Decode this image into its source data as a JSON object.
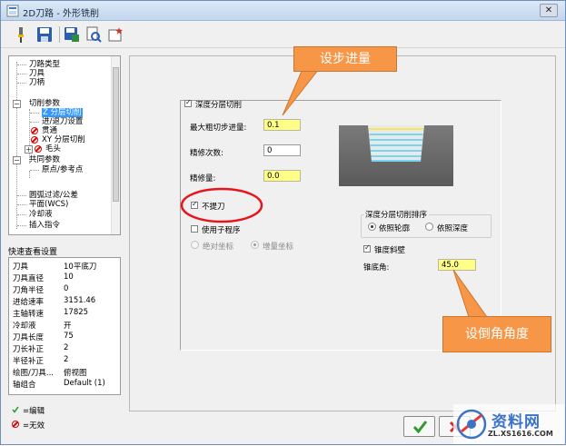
{
  "window": {
    "title": "2D刀路 - 外形铣削"
  },
  "toolbar": {
    "icons": [
      "tool-icon",
      "save-icon",
      "save-as-icon",
      "view-icon",
      "new-icon"
    ]
  },
  "tree": {
    "items": [
      {
        "label": "刀路类型"
      },
      {
        "label": "刀具"
      },
      {
        "label": "刀柄"
      },
      {
        "label": "切削参数"
      },
      {
        "label": "Z 分层切削"
      },
      {
        "label": "进/退刀设置"
      },
      {
        "label": "贯通"
      },
      {
        "label": "XY 分层切削"
      },
      {
        "label": "毛头"
      },
      {
        "label": "共同参数"
      },
      {
        "label": "原点/参考点"
      },
      {
        "label": "圆弧过滤/公差"
      },
      {
        "label": "平面(WCS)"
      },
      {
        "label": "冷却液"
      },
      {
        "label": "插入指令"
      }
    ]
  },
  "quick_view": {
    "label": "快速查看设置",
    "rows": [
      {
        "key": "刀具",
        "value": "10平底刀"
      },
      {
        "key": "刀具直径",
        "value": "10"
      },
      {
        "key": "刀角半径",
        "value": "0"
      },
      {
        "key": "进给速率",
        "value": "3151.46"
      },
      {
        "key": "主轴转速",
        "value": "17825"
      },
      {
        "key": "冷却液",
        "value": "开"
      },
      {
        "key": "刀具长度",
        "value": "75"
      },
      {
        "key": "刀长补正",
        "value": "2"
      },
      {
        "key": "半径补正",
        "value": "2"
      },
      {
        "key": "绘图/刀具...",
        "value": "俯视图"
      },
      {
        "key": "轴组合",
        "value": "Default (1)"
      }
    ]
  },
  "legend": {
    "edited": "=编辑",
    "disabled": "=无效"
  },
  "depth": {
    "enable_label": "深度分层切削",
    "max_rough_label": "最大粗切步进量:",
    "max_rough_value": "0.1",
    "finish_count_label": "精修次数:",
    "finish_count_value": "0",
    "finish_amount_label": "精修量:",
    "finish_amount_value": "0.0",
    "no_lift_label": "不提刀",
    "use_subprogram_label": "使用子程序",
    "absolute_label": "绝对坐标",
    "incremental_label": "增量坐标",
    "order_group_label": "深度分层切削排序",
    "by_contour_label": "依照轮廓",
    "by_depth_label": "依照深度",
    "taper_label": "锥度斜壁",
    "taper_angle_label": "锥底角:",
    "taper_angle_value": "45.0"
  },
  "callouts": {
    "step": "设步进量",
    "angle": "设倒角角度"
  },
  "buttons": {
    "ok": "✓",
    "cancel": "✗"
  },
  "watermark": {
    "brand": "资料网",
    "url": "ZL.XS1616.COM"
  },
  "colors": {
    "callout": "#f79646",
    "highlight_field": "#ffff88",
    "ring": "#e8141b"
  }
}
